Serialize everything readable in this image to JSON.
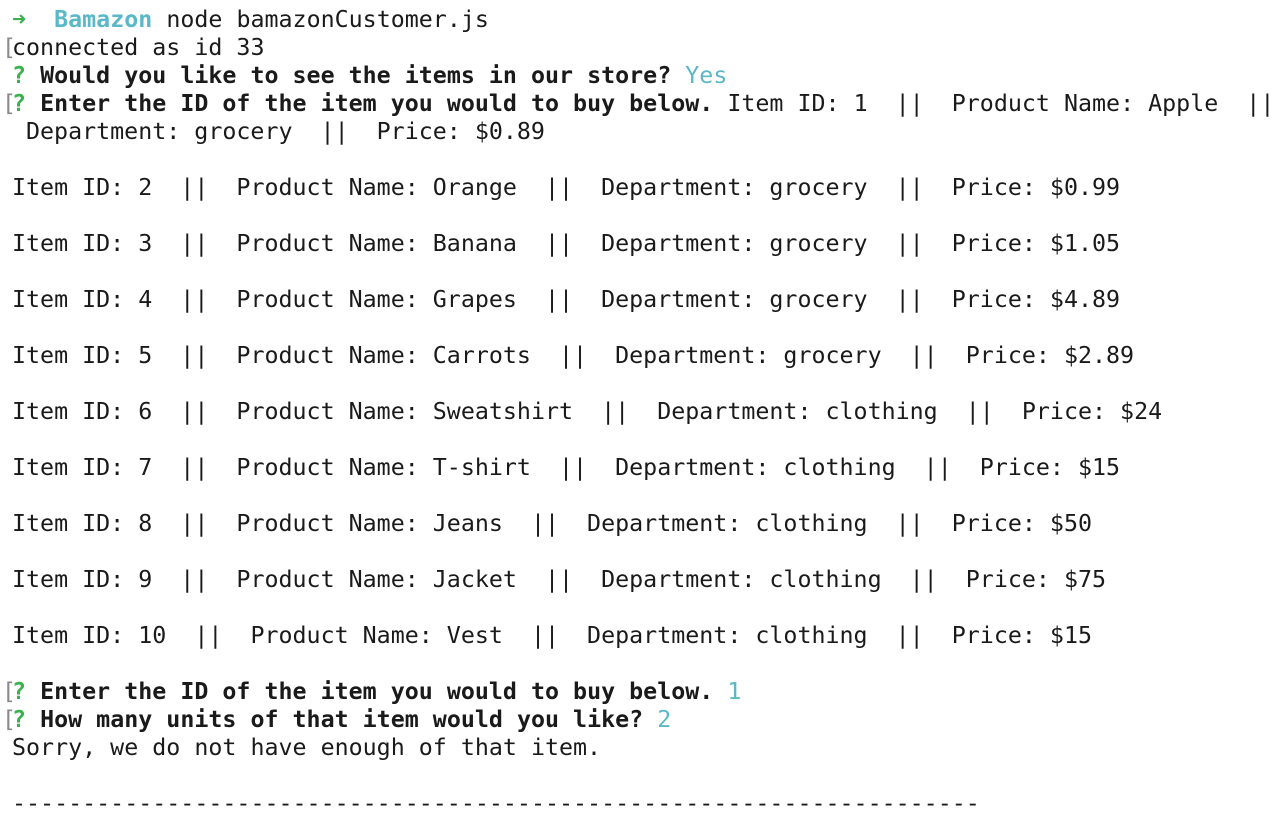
{
  "terminal": {
    "prompt": {
      "arrow": "➜",
      "directory": "Bamazon",
      "command": "node bamazonCustomer.js"
    },
    "connection": "connected as id 33",
    "q1": {
      "mark": "?",
      "question": "Would you like to see the items in our store?",
      "answer": "Yes"
    },
    "q2": {
      "mark": "?",
      "question": "Enter the ID of the item you would to buy below.",
      "inline": "Item ID: 1  ||  Product Name: Apple  ||",
      "wrap": "Department: grocery  ||  Price: $0.89"
    },
    "items": [
      "Item ID: 2  ||  Product Name: Orange  ||  Department: grocery  ||  Price: $0.99",
      "Item ID: 3  ||  Product Name: Banana  ||  Department: grocery  ||  Price: $1.05",
      "Item ID: 4  ||  Product Name: Grapes  ||  Department: grocery  ||  Price: $4.89",
      "Item ID: 5  ||  Product Name: Carrots  ||  Department: grocery  ||  Price: $2.89",
      "Item ID: 6  ||  Product Name: Sweatshirt  ||  Department: clothing  ||  Price: $24",
      "Item ID: 7  ||  Product Name: T-shirt  ||  Department: clothing  ||  Price: $15",
      "Item ID: 8  ||  Product Name: Jeans  ||  Department: clothing  ||  Price: $50",
      "Item ID: 9  ||  Product Name: Jacket  ||  Department: clothing  ||  Price: $75",
      "Item ID: 10  ||  Product Name: Vest  ||  Department: clothing  ||  Price: $15"
    ],
    "q3": {
      "mark": "?",
      "question": "Enter the ID of the item you would to buy below.",
      "answer": "1"
    },
    "q4": {
      "mark": "?",
      "question": "How many units of that item would you like?",
      "answer": "2"
    },
    "message": "Sorry, we do not have enough of that item.",
    "separator": "---------------------------------------------------------------------",
    "bracket": "["
  },
  "colors": {
    "arrow": "#37b24d",
    "directory": "#5bb8c7",
    "answer": "#5bb8c7",
    "question_mark": "#37b24d",
    "text": "#1a1a1a"
  }
}
